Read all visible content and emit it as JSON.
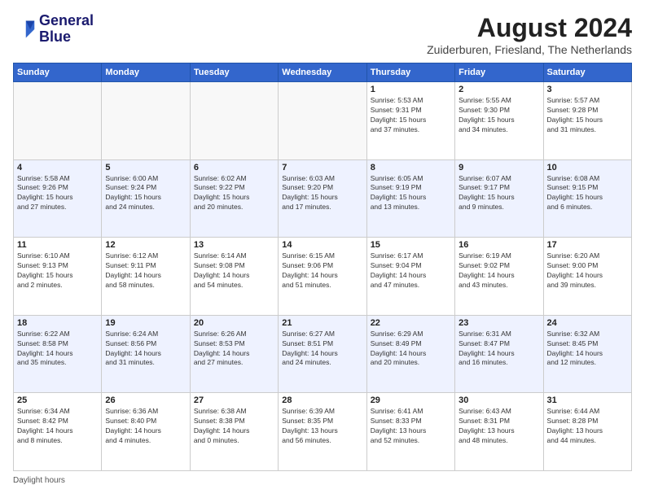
{
  "logo": {
    "line1": "General",
    "line2": "Blue"
  },
  "title": "August 2024",
  "subtitle": "Zuiderburen, Friesland, The Netherlands",
  "days_of_week": [
    "Sunday",
    "Monday",
    "Tuesday",
    "Wednesday",
    "Thursday",
    "Friday",
    "Saturday"
  ],
  "footer": "Daylight hours",
  "weeks": [
    [
      {
        "day": "",
        "info": ""
      },
      {
        "day": "",
        "info": ""
      },
      {
        "day": "",
        "info": ""
      },
      {
        "day": "",
        "info": ""
      },
      {
        "day": "1",
        "info": "Sunrise: 5:53 AM\nSunset: 9:31 PM\nDaylight: 15 hours\nand 37 minutes."
      },
      {
        "day": "2",
        "info": "Sunrise: 5:55 AM\nSunset: 9:30 PM\nDaylight: 15 hours\nand 34 minutes."
      },
      {
        "day": "3",
        "info": "Sunrise: 5:57 AM\nSunset: 9:28 PM\nDaylight: 15 hours\nand 31 minutes."
      }
    ],
    [
      {
        "day": "4",
        "info": "Sunrise: 5:58 AM\nSunset: 9:26 PM\nDaylight: 15 hours\nand 27 minutes."
      },
      {
        "day": "5",
        "info": "Sunrise: 6:00 AM\nSunset: 9:24 PM\nDaylight: 15 hours\nand 24 minutes."
      },
      {
        "day": "6",
        "info": "Sunrise: 6:02 AM\nSunset: 9:22 PM\nDaylight: 15 hours\nand 20 minutes."
      },
      {
        "day": "7",
        "info": "Sunrise: 6:03 AM\nSunset: 9:20 PM\nDaylight: 15 hours\nand 17 minutes."
      },
      {
        "day": "8",
        "info": "Sunrise: 6:05 AM\nSunset: 9:19 PM\nDaylight: 15 hours\nand 13 minutes."
      },
      {
        "day": "9",
        "info": "Sunrise: 6:07 AM\nSunset: 9:17 PM\nDaylight: 15 hours\nand 9 minutes."
      },
      {
        "day": "10",
        "info": "Sunrise: 6:08 AM\nSunset: 9:15 PM\nDaylight: 15 hours\nand 6 minutes."
      }
    ],
    [
      {
        "day": "11",
        "info": "Sunrise: 6:10 AM\nSunset: 9:13 PM\nDaylight: 15 hours\nand 2 minutes."
      },
      {
        "day": "12",
        "info": "Sunrise: 6:12 AM\nSunset: 9:11 PM\nDaylight: 14 hours\nand 58 minutes."
      },
      {
        "day": "13",
        "info": "Sunrise: 6:14 AM\nSunset: 9:08 PM\nDaylight: 14 hours\nand 54 minutes."
      },
      {
        "day": "14",
        "info": "Sunrise: 6:15 AM\nSunset: 9:06 PM\nDaylight: 14 hours\nand 51 minutes."
      },
      {
        "day": "15",
        "info": "Sunrise: 6:17 AM\nSunset: 9:04 PM\nDaylight: 14 hours\nand 47 minutes."
      },
      {
        "day": "16",
        "info": "Sunrise: 6:19 AM\nSunset: 9:02 PM\nDaylight: 14 hours\nand 43 minutes."
      },
      {
        "day": "17",
        "info": "Sunrise: 6:20 AM\nSunset: 9:00 PM\nDaylight: 14 hours\nand 39 minutes."
      }
    ],
    [
      {
        "day": "18",
        "info": "Sunrise: 6:22 AM\nSunset: 8:58 PM\nDaylight: 14 hours\nand 35 minutes."
      },
      {
        "day": "19",
        "info": "Sunrise: 6:24 AM\nSunset: 8:56 PM\nDaylight: 14 hours\nand 31 minutes."
      },
      {
        "day": "20",
        "info": "Sunrise: 6:26 AM\nSunset: 8:53 PM\nDaylight: 14 hours\nand 27 minutes."
      },
      {
        "day": "21",
        "info": "Sunrise: 6:27 AM\nSunset: 8:51 PM\nDaylight: 14 hours\nand 24 minutes."
      },
      {
        "day": "22",
        "info": "Sunrise: 6:29 AM\nSunset: 8:49 PM\nDaylight: 14 hours\nand 20 minutes."
      },
      {
        "day": "23",
        "info": "Sunrise: 6:31 AM\nSunset: 8:47 PM\nDaylight: 14 hours\nand 16 minutes."
      },
      {
        "day": "24",
        "info": "Sunrise: 6:32 AM\nSunset: 8:45 PM\nDaylight: 14 hours\nand 12 minutes."
      }
    ],
    [
      {
        "day": "25",
        "info": "Sunrise: 6:34 AM\nSunset: 8:42 PM\nDaylight: 14 hours\nand 8 minutes."
      },
      {
        "day": "26",
        "info": "Sunrise: 6:36 AM\nSunset: 8:40 PM\nDaylight: 14 hours\nand 4 minutes."
      },
      {
        "day": "27",
        "info": "Sunrise: 6:38 AM\nSunset: 8:38 PM\nDaylight: 14 hours\nand 0 minutes."
      },
      {
        "day": "28",
        "info": "Sunrise: 6:39 AM\nSunset: 8:35 PM\nDaylight: 13 hours\nand 56 minutes."
      },
      {
        "day": "29",
        "info": "Sunrise: 6:41 AM\nSunset: 8:33 PM\nDaylight: 13 hours\nand 52 minutes."
      },
      {
        "day": "30",
        "info": "Sunrise: 6:43 AM\nSunset: 8:31 PM\nDaylight: 13 hours\nand 48 minutes."
      },
      {
        "day": "31",
        "info": "Sunrise: 6:44 AM\nSunset: 8:28 PM\nDaylight: 13 hours\nand 44 minutes."
      }
    ]
  ]
}
